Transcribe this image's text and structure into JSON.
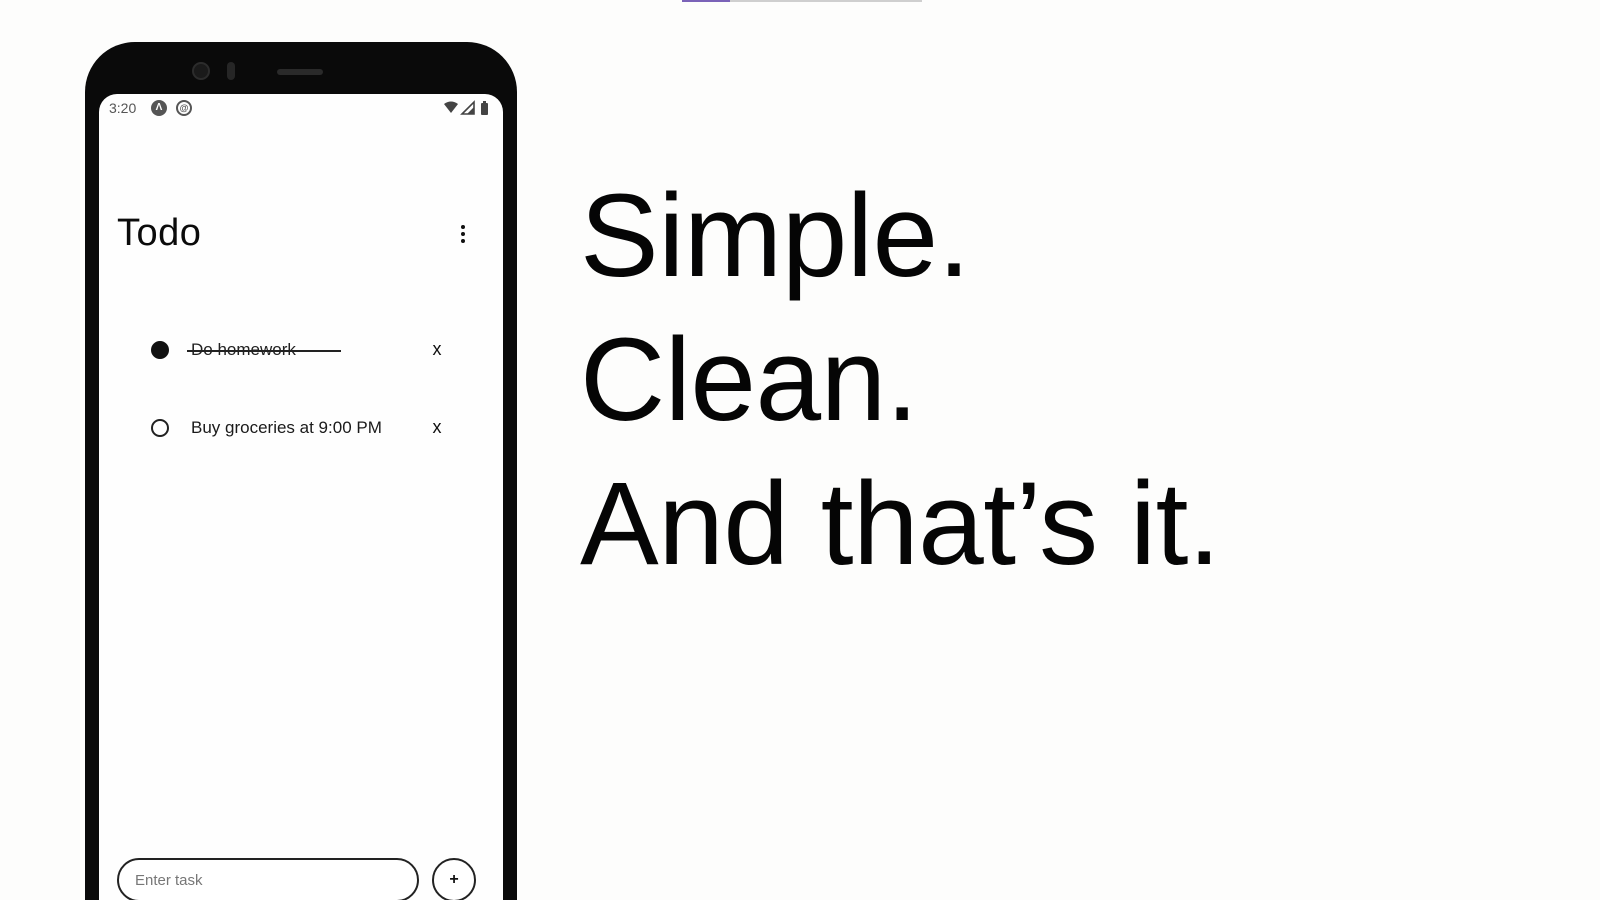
{
  "status_bar": {
    "time": "3:20",
    "app_icons": [
      "a-icon",
      "at-icon"
    ],
    "system_icons": [
      "wifi-icon",
      "signal-icon",
      "battery-icon"
    ]
  },
  "app": {
    "title": "Todo",
    "menu_icon": "more-vert-icon"
  },
  "tasks": [
    {
      "text": "Do homework",
      "completed": true,
      "delete_label": "x"
    },
    {
      "text": "Buy groceries at 9:00 PM",
      "completed": false,
      "delete_label": "x"
    }
  ],
  "input": {
    "placeholder": "Enter task",
    "value": ""
  },
  "add_button": {
    "label": "+"
  },
  "headline": {
    "lines": [
      "Simple.",
      "Clean.",
      "And that’s it."
    ]
  },
  "colors": {
    "background": "#fdfdfc",
    "phone_body": "#0a0a0a",
    "text": "#050505",
    "accent": "#7b63b8"
  }
}
